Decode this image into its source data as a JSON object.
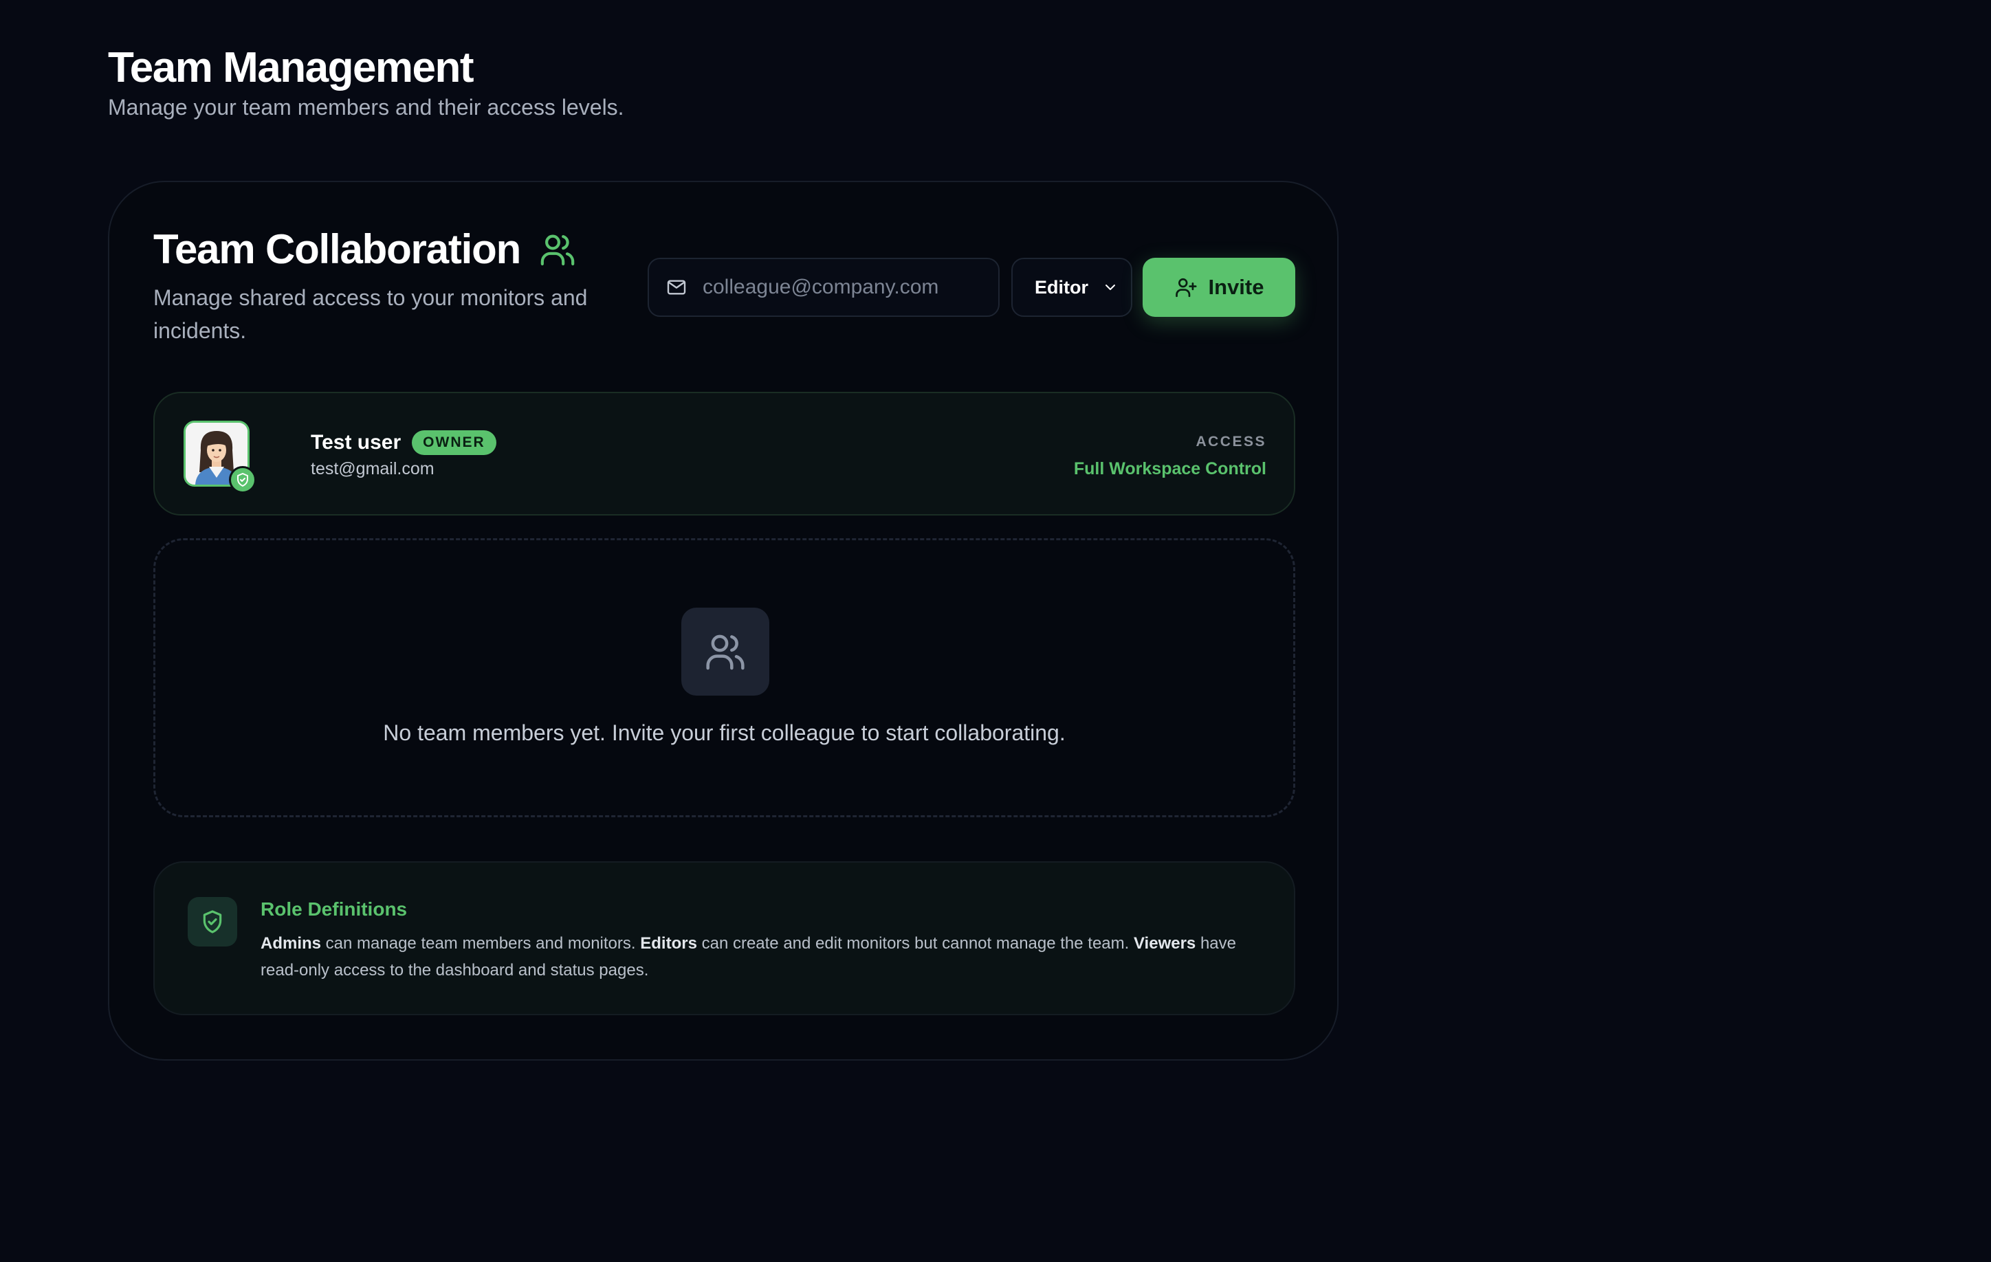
{
  "header": {
    "title": "Team Management",
    "subtitle": "Manage your team members and their access levels."
  },
  "card": {
    "title": "Team Collaboration",
    "title_icon": "users-icon",
    "subtitle": "Manage shared access to your monitors and incidents."
  },
  "invite_form": {
    "email_icon": "mail-icon",
    "email_placeholder": "colleague@company.com",
    "email_value": "",
    "role_selected": "Editor",
    "invite_label": "Invite",
    "invite_icon": "user-plus-icon"
  },
  "owner": {
    "name": "Test user",
    "badge": "OWNER",
    "email": "test@gmail.com",
    "access_label": "ACCESS",
    "access_value": "Full Workspace Control"
  },
  "empty_state": {
    "icon": "users-icon",
    "message": "No team members yet. Invite your first colleague to start collaborating."
  },
  "roles": {
    "icon": "shield-check-icon",
    "title": "Role Definitions",
    "admins_term": "Admins",
    "admins_desc": " can manage team members and monitors. ",
    "editors_term": "Editors",
    "editors_desc": " can create and edit monitors but cannot manage the team. ",
    "viewers_term": "Viewers",
    "viewers_desc": " have read-only access to the dashboard and status pages."
  },
  "colors": {
    "background": "#060913",
    "accent": "#5ac26d",
    "muted_text": "#a9b0bd"
  }
}
